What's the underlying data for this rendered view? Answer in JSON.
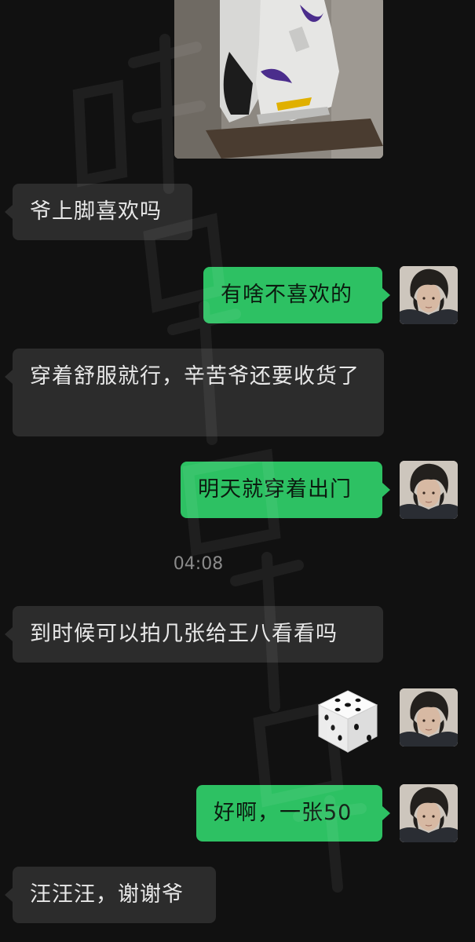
{
  "messages": [
    {
      "side": "in",
      "text": "爷上脚喜欢吗"
    },
    {
      "side": "out",
      "text": "有啥不喜欢的"
    },
    {
      "side": "in",
      "text": "穿着舒服就行，辛苦爷还要收货了"
    },
    {
      "side": "out",
      "text": "明天就穿着出门"
    },
    {
      "side": "in",
      "text": "到时候可以拍几张给王八看看吗"
    },
    {
      "side": "out",
      "text": "好啊，一张50"
    },
    {
      "side": "in",
      "text": "汪汪汪，谢谢爷"
    }
  ],
  "timestamp": "04:08",
  "dice_value": 5,
  "icons": {
    "dice": "dice-icon",
    "avatar": "user-avatar",
    "photo": "shoe-photo"
  },
  "colors": {
    "background": "#111111",
    "incoming_bubble": "#2c2c2c",
    "outgoing_bubble": "#2dc163"
  }
}
